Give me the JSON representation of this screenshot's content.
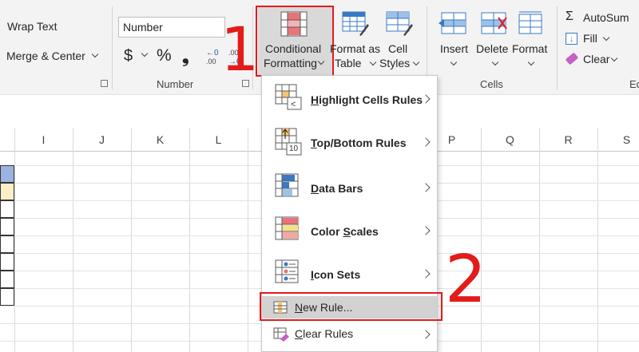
{
  "ribbon": {
    "wrap_text": "Wrap Text",
    "merge_center": "Merge & Center",
    "number_format": "Number",
    "currency": "$",
    "percent": "%",
    "comma": "❟",
    "number_group": "Number",
    "conditional_formatting_line1": "Conditional",
    "conditional_formatting_line2": "Formatting",
    "format_as_table_line1": "Format as",
    "format_as_table_line2": "Table",
    "cell_styles_line1": "Cell",
    "cell_styles_line2": "Styles",
    "insert": "Insert",
    "delete": "Delete",
    "format": "Format",
    "cells_group": "Cells",
    "autosum": "AutoSum",
    "fill": "Fill",
    "clear": "Clear",
    "editing_group_partial": "Ed"
  },
  "columns": [
    "I",
    "J",
    "K",
    "L",
    "P",
    "Q",
    "R",
    "S"
  ],
  "menu": {
    "items": [
      {
        "label": "Highlight Cells Rules",
        "underline": "H",
        "rest": "ighlight Cells Rules"
      },
      {
        "label": "Top/Bottom Rules",
        "underline": "T",
        "rest": "op/Bottom Rules"
      },
      {
        "label": "Data Bars",
        "underline": "D",
        "rest": "ata Bars"
      },
      {
        "label": "Color Scales",
        "underline": "S",
        "prefix": "Color ",
        "rest": "cales"
      },
      {
        "label": "Icon Sets",
        "underline": "I",
        "rest": "con Sets"
      }
    ],
    "new_rule": "New Rule...",
    "new_rule_underline": "N",
    "new_rule_rest": "ew Rule...",
    "clear_rules": "Clear Rules",
    "clear_rules_underline": "C",
    "clear_rules_rest": "lear Rules",
    "icon_text_top10": "10"
  },
  "annotations": {
    "step1": "1",
    "step2": "2"
  },
  "colors": {
    "highlight": "#e31b1b",
    "ribbon_bg": "#f3f3f3"
  }
}
